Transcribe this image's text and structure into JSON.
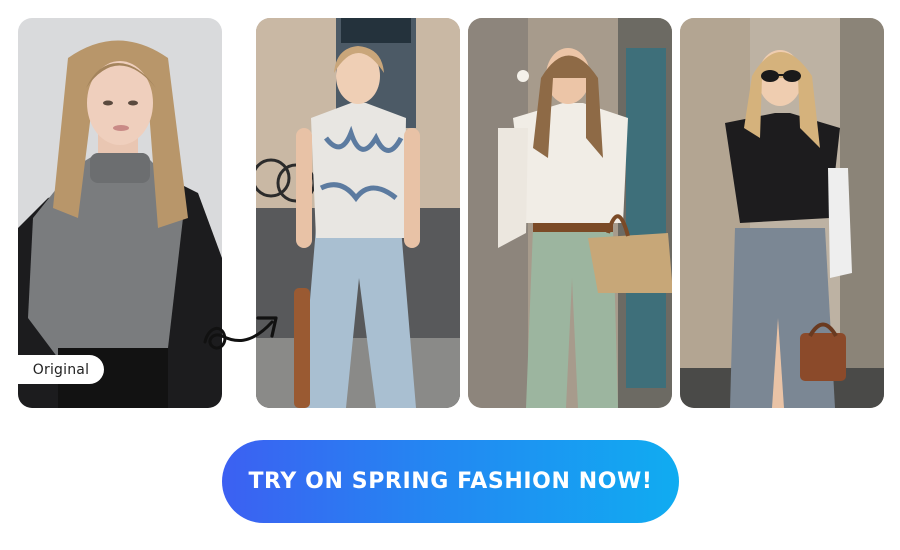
{
  "photos": [
    {
      "id": "original",
      "badge_label": "Original"
    },
    {
      "id": "look-1"
    },
    {
      "id": "look-2"
    },
    {
      "id": "look-3"
    }
  ],
  "arrow_icon": "curly-arrow-icon",
  "cta": {
    "label": "TRY ON SPRING FASHION NOW!",
    "gradient_start": "#3c60f2",
    "gradient_end": "#10acf1"
  },
  "colors": {
    "background": "#ffffff",
    "badge_bg": "#ffffff",
    "badge_text": "#222222",
    "cta_text": "#ffffff"
  }
}
